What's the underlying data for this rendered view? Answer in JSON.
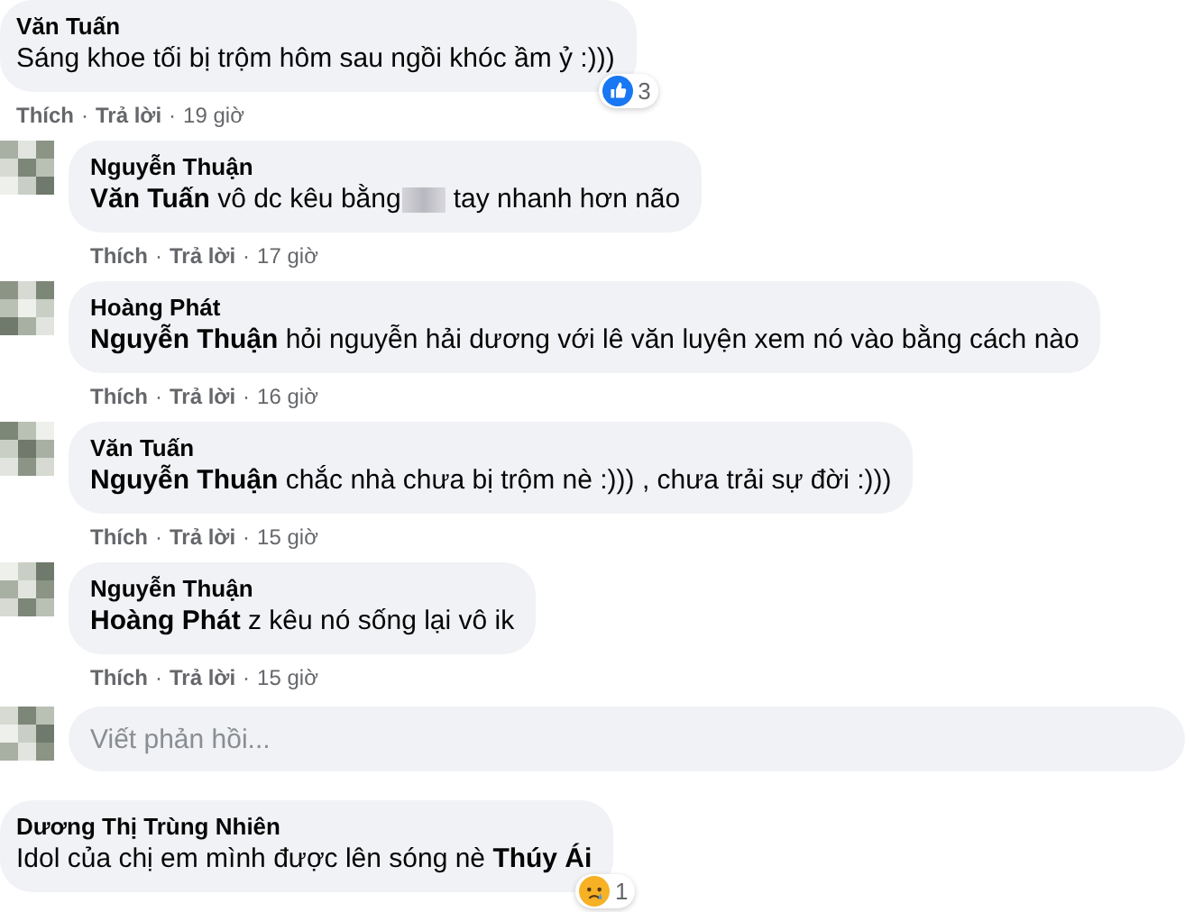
{
  "comments": [
    {
      "author": "Văn Tuấn",
      "body": [
        {
          "kind": "text",
          "text": "Sáng khoe tối bị trộm hôm sau ngồi khóc ầm ỷ :)))"
        }
      ],
      "reaction": {
        "kind": "like",
        "count": "3"
      },
      "actions": {
        "like": "Thích",
        "sep1": "·",
        "reply": "Trả lời",
        "sep2": "·",
        "time": "19 giờ"
      },
      "replies": [
        {
          "author": "Nguyễn Thuận",
          "body": [
            {
              "kind": "text",
              "text": "**Văn Tuấn** vô dc kêu bằng"
            },
            {
              "kind": "censored"
            },
            {
              "kind": "text",
              "text": "tay nhanh hơn não"
            }
          ],
          "actions": {
            "like": "Thích",
            "sep1": "·",
            "reply": "Trả lời",
            "sep2": "·",
            "time": "17 giờ"
          }
        },
        {
          "author": "Hoàng Phát",
          "body": [
            {
              "kind": "text",
              "text": "**Nguyễn Thuận** hỏi nguyễn hải dương với lê văn luyện xem nó vào bằng cách nào"
            }
          ],
          "actions": {
            "like": "Thích",
            "sep1": "·",
            "reply": "Trả lời",
            "sep2": "·",
            "time": "16 giờ"
          }
        },
        {
          "author": "Văn Tuấn",
          "body": [
            {
              "kind": "text",
              "text": "**Nguyễn Thuận** chắc nhà chưa bị trộm nè :))) , chưa trải sự đời :)))"
            }
          ],
          "actions": {
            "like": "Thích",
            "sep1": "·",
            "reply": "Trả lời",
            "sep2": "·",
            "time": "15 giờ"
          }
        },
        {
          "author": "Nguyễn Thuận",
          "body": [
            {
              "kind": "text",
              "text": "**Hoàng Phát** z kêu nó sống lại vô ik"
            }
          ],
          "actions": {
            "like": "Thích",
            "sep1": "·",
            "reply": "Trả lời",
            "sep2": "·",
            "time": "15 giờ"
          }
        }
      ],
      "reply_box": {
        "placeholder": "Viết phản hồi..."
      }
    },
    {
      "author": "Dương Thị Trùng Nhiên",
      "body": [
        {
          "kind": "text",
          "text": "Idol của chị em mình được lên sóng nè **Thúy Ái**"
        }
      ],
      "reaction": {
        "kind": "sad",
        "count": "1"
      }
    }
  ]
}
